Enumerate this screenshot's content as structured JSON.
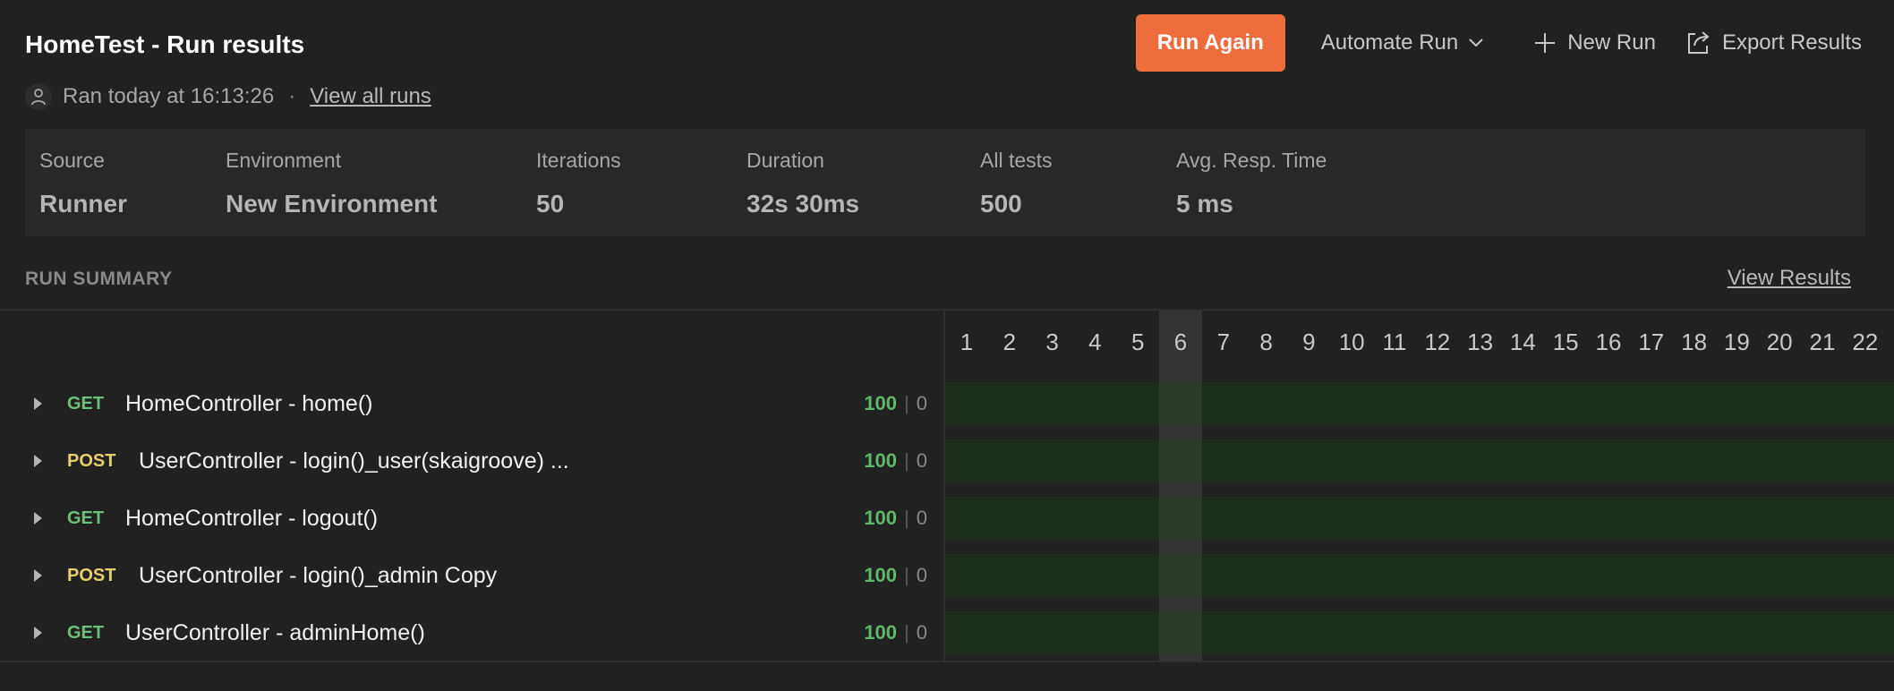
{
  "header": {
    "title": "HomeTest - Run results",
    "ran_text": "Ran today at 16:13:26",
    "separator": "·",
    "view_all_runs": "View all runs"
  },
  "actions": {
    "run_again": "Run Again",
    "automate_run": "Automate Run",
    "new_run": "New Run",
    "export_results": "Export Results"
  },
  "info": [
    {
      "label": "Source",
      "value": "Runner"
    },
    {
      "label": "Environment",
      "value": "New Environment"
    },
    {
      "label": "Iterations",
      "value": "50"
    },
    {
      "label": "Duration",
      "value": "32s 30ms"
    },
    {
      "label": "All tests",
      "value": "500"
    },
    {
      "label": "Avg. Resp. Time",
      "value": "5 ms"
    }
  ],
  "summary": {
    "title": "RUN SUMMARY",
    "view_results": "View Results",
    "iterations": [
      "1",
      "2",
      "3",
      "4",
      "5",
      "6",
      "7",
      "8",
      "9",
      "10",
      "11",
      "12",
      "13",
      "14",
      "15",
      "16",
      "17",
      "18",
      "19",
      "20",
      "21",
      "22"
    ],
    "selected_iteration": "6",
    "requests": [
      {
        "method": "GET",
        "name": "HomeController - home()",
        "passed": "100",
        "failed": "0"
      },
      {
        "method": "POST",
        "name": "UserController - login()_user(skaigroove) ...",
        "passed": "100",
        "failed": "0"
      },
      {
        "method": "GET",
        "name": "HomeController - logout()",
        "passed": "100",
        "failed": "0"
      },
      {
        "method": "POST",
        "name": "UserController - login()_admin Copy",
        "passed": "100",
        "failed": "0"
      },
      {
        "method": "GET",
        "name": "UserController - adminHome()",
        "passed": "100",
        "failed": "0"
      }
    ]
  },
  "colors": {
    "accent": "#ef6c3d",
    "pass": "#5fb86a",
    "get_method": "#6bbf7a",
    "post_method": "#e6cf6a",
    "pass_band": "#1a2e1a"
  }
}
